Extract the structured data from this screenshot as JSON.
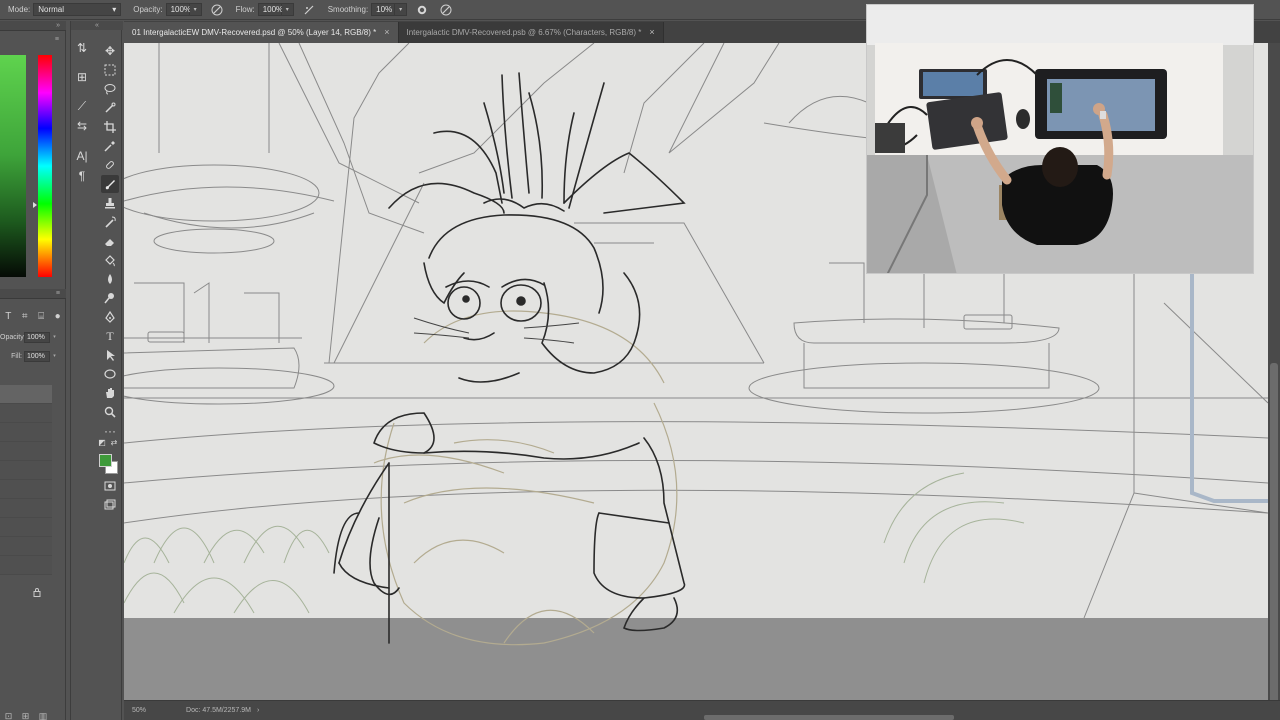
{
  "options_bar": {
    "mode_label": "Mode:",
    "mode_value": "Normal",
    "opacity_label": "Opacity:",
    "opacity_value": "100%",
    "flow_label": "Flow:",
    "flow_value": "100%",
    "smoothing_label": "Smoothing:",
    "smoothing_value": "10%",
    "icons": [
      "pressure-opacity-icon",
      "airbrush-icon",
      "pressure-size-icon",
      "gear-icon",
      "symmetry-icon"
    ]
  },
  "layers_panel": {
    "opacity_label": "Opacity:",
    "opacity_value": "100%",
    "fill_label": "Fill:",
    "fill_value": "100%",
    "lock_icons": [
      "T",
      "⌗",
      "⌸",
      "●"
    ]
  },
  "tools": {
    "collapse": "«",
    "items": [
      "move-tool-icon",
      "marquee-tool-icon",
      "lasso-tool-icon",
      "quick-select-tool-icon",
      "crop-tool-icon",
      "eyedropper-tool-icon",
      "healing-tool-icon",
      "brush-tool-icon",
      "stamp-tool-icon",
      "history-brush-icon",
      "eraser-tool-icon",
      "gradient-tool-icon",
      "blur-tool-icon",
      "dodge-tool-icon",
      "pen-tool-icon",
      "type-tool-icon",
      "path-select-tool-icon",
      "shape-tool-icon",
      "hand-tool-icon",
      "zoom-tool-icon",
      "more-tools-icon"
    ]
  },
  "colors": {
    "foreground": "#3e9a3a",
    "background": "#ffffff",
    "accent": "#3e9a3a"
  },
  "tabs": [
    {
      "label": "01 IntergalacticEW DMV-Recovered.psd @ 50% (Layer 14, RGB/8) *",
      "active": true
    },
    {
      "label": "Intergalactic DMV-Recovered.psb @ 6.67% (Characters, RGB/8) *",
      "active": false
    }
  ],
  "status": {
    "zoom": "50%",
    "doc_info": "Doc: 47.5M/2257.9M"
  }
}
